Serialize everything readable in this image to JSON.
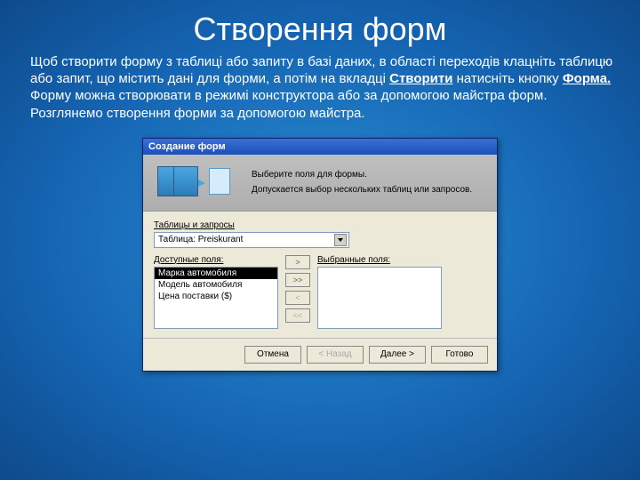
{
  "slide": {
    "title": "Створення форм",
    "paragraph_pre": "Щоб створити форму з таблиці або запиту в базі даних, в області переходів клацніть таблицю або запит, що містить дані для форми, а потім на вкладці ",
    "word_create": "Створити",
    "mid": " натисніть кнопку ",
    "word_form": "Форма.",
    "paragraph_post": " Форму можна створювати в режимі конструктора або за допомогою майстра форм. Розглянемо створення форми за допомогою майстра."
  },
  "dialog": {
    "title": "Создание форм",
    "banner_line1": "Выберите поля для формы.",
    "banner_line2": "Допускается выбор нескольких таблиц или запросов.",
    "tables_label": "Таблицы и запросы",
    "combo_value": "Таблица: Preiskurant",
    "available_label": "Доступные поля:",
    "selected_label": "Выбранные поля:",
    "available_items": [
      "Марка автомобиля",
      "Модель автомобиля",
      "Цена поставки ($)"
    ],
    "btn_add": ">",
    "btn_add_all": ">>",
    "btn_remove": "<",
    "btn_remove_all": "<<",
    "footer": {
      "cancel": "Отмена",
      "back": "< Назад",
      "next": "Далее >",
      "finish": "Готово"
    }
  }
}
